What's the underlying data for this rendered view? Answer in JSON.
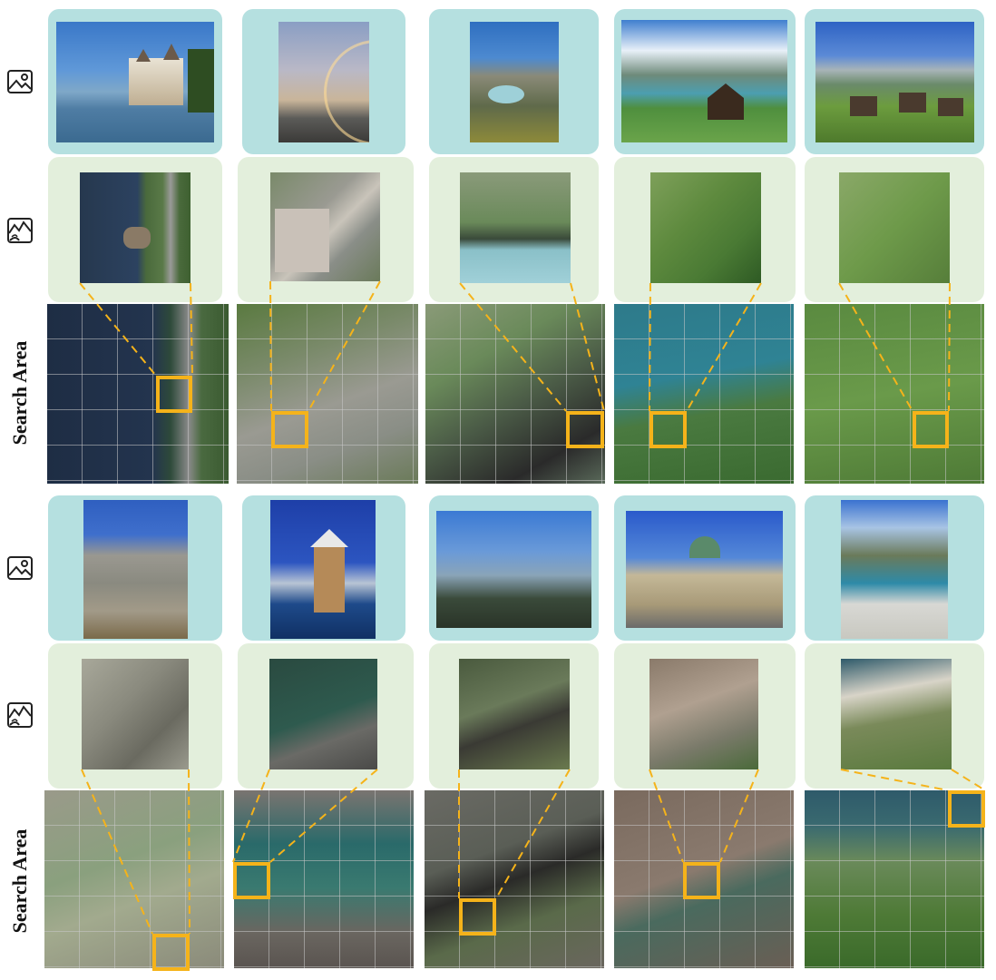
{
  "row_labels": {
    "search_area": "Search Area"
  },
  "icons": {
    "ground_icon": "image-icon",
    "drone_icon": "drone-view-icon"
  },
  "colors": {
    "ground_panel": "#b5e0e0",
    "drone_panel": "#e3efdc",
    "highlight": "#f5b31a"
  }
}
